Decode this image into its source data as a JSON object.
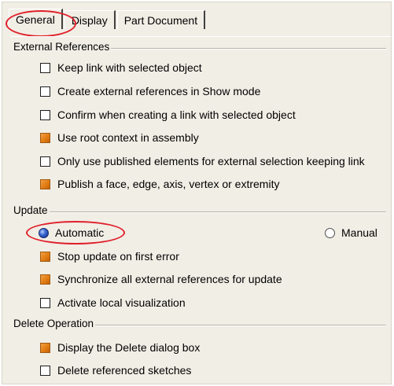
{
  "tabs": [
    {
      "label": "General",
      "active": true
    },
    {
      "label": "Display",
      "active": false
    },
    {
      "label": "Part Document",
      "active": false
    }
  ],
  "external_references": {
    "title": "External References",
    "options": [
      {
        "label": "Keep link with selected object",
        "checked": false
      },
      {
        "label": "Create external references in Show mode",
        "checked": false
      },
      {
        "label": "Confirm when creating a link with selected object",
        "checked": false
      },
      {
        "label": "Use root context in assembly",
        "checked": true
      },
      {
        "label": "Only use published elements for external selection keeping link",
        "checked": false
      },
      {
        "label": "Publish a face, edge, axis, vertex or extremity",
        "checked": true
      }
    ]
  },
  "update": {
    "title": "Update",
    "mode_options": [
      {
        "label": "Automatic",
        "selected": true
      },
      {
        "label": "Manual",
        "selected": false
      }
    ],
    "options": [
      {
        "label": "Stop update on first error",
        "checked": true
      },
      {
        "label": "Synchronize all external references for update",
        "checked": true
      },
      {
        "label": "Activate local visualization",
        "checked": false
      }
    ]
  },
  "delete_operation": {
    "title": "Delete Operation",
    "options": [
      {
        "label": "Display the Delete dialog box",
        "checked": true
      },
      {
        "label": "Delete referenced sketches",
        "checked": false
      }
    ]
  },
  "colors": {
    "panel_bg": "#f1eee6",
    "checked_orange": "#e07a10",
    "radio_blue": "#3a68d0",
    "highlight_red": "#e0202a"
  }
}
